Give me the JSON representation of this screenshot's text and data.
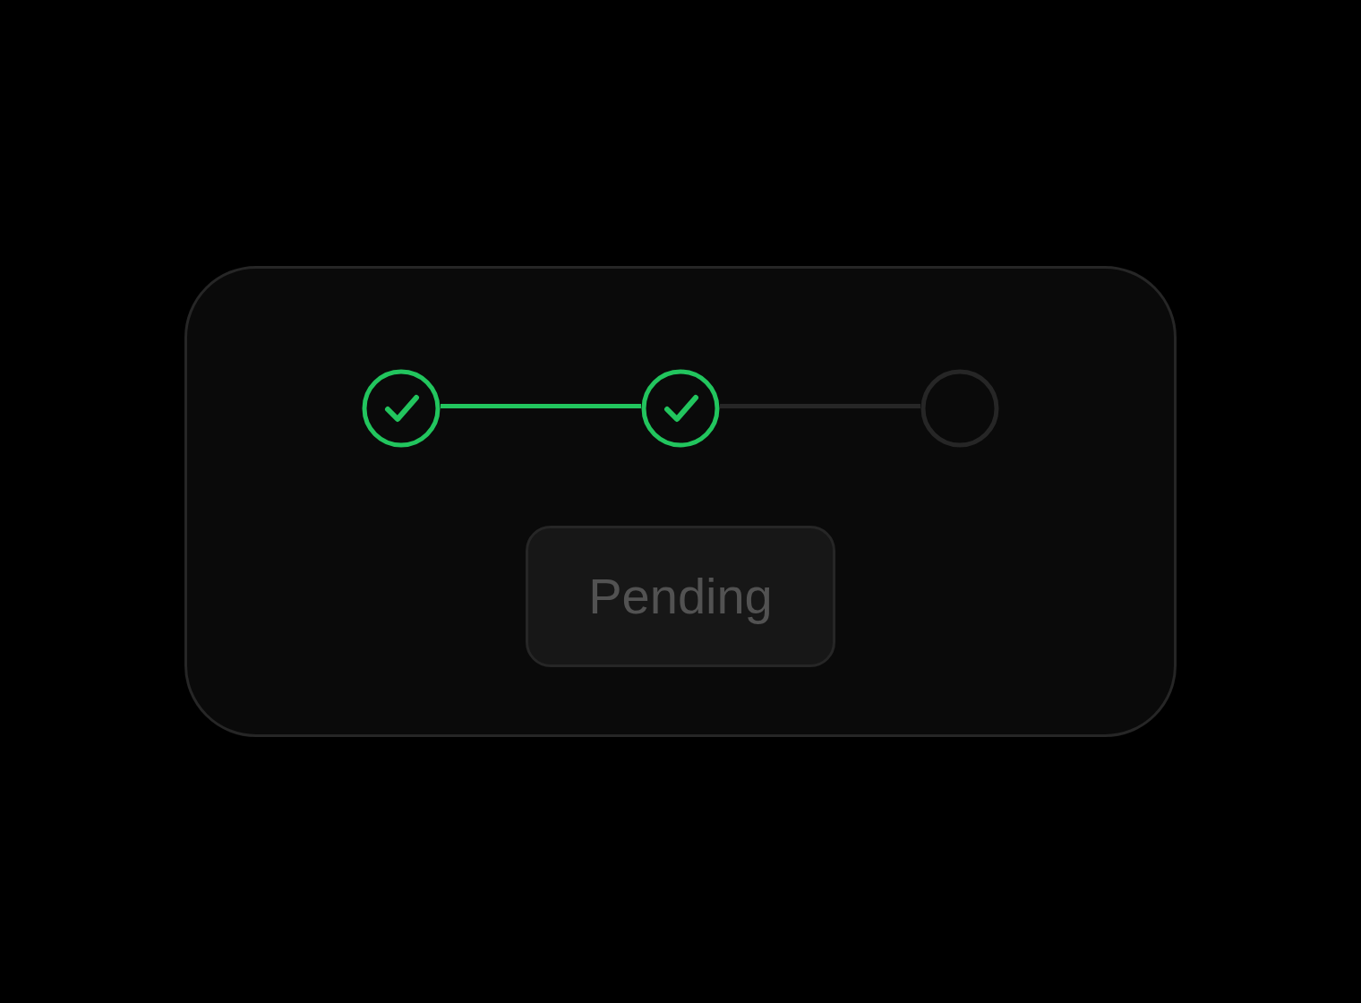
{
  "steps": [
    {
      "completed": true
    },
    {
      "completed": true
    },
    {
      "completed": false
    }
  ],
  "button": {
    "label": "Pending",
    "disabled": true
  }
}
